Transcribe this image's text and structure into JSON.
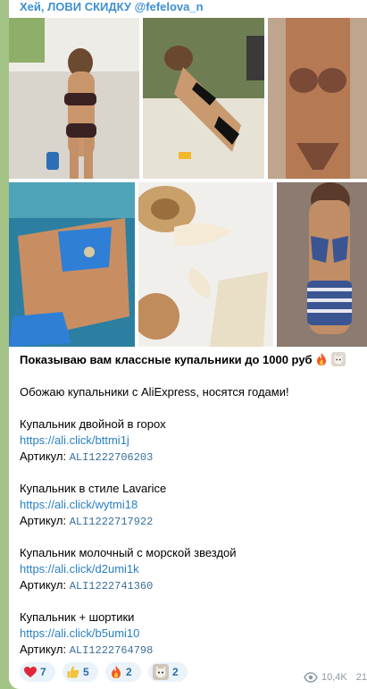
{
  "sender": "Хей, ЛОВИ СКИДКУ @fefelova_n",
  "photos": [
    {
      "name": "photo-1"
    },
    {
      "name": "photo-2"
    },
    {
      "name": "photo-3"
    },
    {
      "name": "photo-4"
    },
    {
      "name": "photo-5"
    },
    {
      "name": "photo-6"
    }
  ],
  "message": {
    "headline": "Показываю вам классные купальники до 1000 руб",
    "intro": "Обожаю купальники с AliExpress, носятся годами!",
    "items": [
      {
        "title": "Купальник двойной в горох",
        "link": "https://ali.click/bttmi1j",
        "sku_label": "Артикул:",
        "sku": "ALI1222706203"
      },
      {
        "title": "Купальник в стиле Lavarice",
        "link": "https://ali.click/wytmi18",
        "sku_label": "Артикул:",
        "sku": "ALI1222717922"
      },
      {
        "title": "Купальник молочный с морской звездой",
        "link": "https://ali.click/d2umi1k",
        "sku_label": "Артикул:",
        "sku": "ALI1222741360"
      },
      {
        "title": "Купальник + шортики",
        "link": "https://ali.click/b5umi10",
        "sku_label": "Артикул:",
        "sku": "ALI1222764798"
      }
    ]
  },
  "reactions": [
    {
      "icon": "heart-icon",
      "count": "7"
    },
    {
      "icon": "thumbs-up-icon",
      "count": "5"
    },
    {
      "icon": "fire-icon",
      "count": "2"
    },
    {
      "icon": "cat-sticker-icon",
      "count": "2"
    }
  ],
  "views": "10,4K",
  "time": "21"
}
